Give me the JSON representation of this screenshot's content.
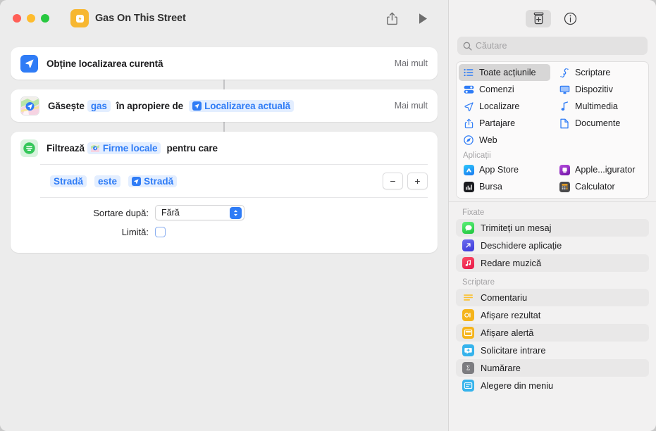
{
  "window": {
    "title": "Gas On This Street",
    "app_icon": "shortcuts-gas-icon",
    "traffic_lights": [
      "close",
      "minimize",
      "zoom"
    ],
    "toolbar": {
      "share_label": "share-icon",
      "run_label": "run-icon"
    }
  },
  "workflow": {
    "actions": [
      {
        "id": "get-current-location",
        "icon": "location-arrow-icon",
        "title": "Obține localizarea curentă",
        "more_label": "Mai mult"
      },
      {
        "id": "find-nearby",
        "icon": "maps-icon",
        "prefix": "Găsește",
        "query_token": "gas",
        "middle": "în apropiere de",
        "location_token": "Localizarea actuală",
        "more_label": "Mai mult"
      },
      {
        "id": "filter-files",
        "icon": "filter-icon",
        "prefix": "Filtrează",
        "subject_token": "Firme locale",
        "suffix": "pentru care",
        "condition": {
          "field": "Stradă",
          "operator": "este",
          "value_token": "Stradă",
          "remove_label": "−",
          "add_label": "+"
        },
        "sort_label": "Sortare după:",
        "sort_value": "Fără",
        "limit_label": "Limită:",
        "limit_checked": false
      }
    ]
  },
  "library": {
    "toolbar": {
      "action_library_icon": "action-library-icon",
      "info_icon": "info-circle-icon"
    },
    "search": {
      "placeholder": "Căutare",
      "value": "",
      "icon": "search-icon"
    },
    "categories": [
      {
        "label": "Toate acțiunile",
        "icon": "list-bullet-icon",
        "selected": true
      },
      {
        "label": "Scriptare",
        "icon": "scripting-icon",
        "selected": false
      },
      {
        "label": "Comenzi",
        "icon": "shortcuts-controls-icon",
        "selected": false
      },
      {
        "label": "Dispozitiv",
        "icon": "display-icon",
        "selected": false
      },
      {
        "label": "Localizare",
        "icon": "location-arrow-icon",
        "selected": false
      },
      {
        "label": "Multimedia",
        "icon": "music-note-icon",
        "selected": false
      },
      {
        "label": "Partajare",
        "icon": "share-icon",
        "selected": false
      },
      {
        "label": "Documente",
        "icon": "document-icon",
        "selected": false
      },
      {
        "label": "Web",
        "icon": "safari-compass-icon",
        "selected": false
      }
    ],
    "apps_heading": "Aplicații",
    "apps": [
      {
        "label": "App Store",
        "icon": "app-store-icon"
      },
      {
        "label": "Apple...igurator",
        "icon": "apple-configurator-icon"
      },
      {
        "label": "Bursa",
        "icon": "stocks-icon"
      },
      {
        "label": "Calculator",
        "icon": "calculator-icon"
      }
    ],
    "sections": [
      {
        "heading": "Fixate",
        "items": [
          {
            "label": "Trimiteți un mesaj",
            "icon": "messages-icon"
          },
          {
            "label": "Deschidere aplicație",
            "icon": "open-app-icon"
          },
          {
            "label": "Redare muzică",
            "icon": "music-icon"
          }
        ]
      },
      {
        "heading": "Scriptare",
        "items": [
          {
            "label": "Comentariu",
            "icon": "comment-icon"
          },
          {
            "label": "Afișare rezultat",
            "icon": "show-result-icon"
          },
          {
            "label": "Afișare alertă",
            "icon": "show-alert-icon"
          },
          {
            "label": "Solicitare intrare",
            "icon": "ask-for-input-icon"
          },
          {
            "label": "Numărare",
            "icon": "count-icon"
          },
          {
            "label": "Alegere din meniu",
            "icon": "choose-from-menu-icon"
          }
        ]
      }
    ]
  },
  "colors": {
    "accent_blue": "#2f7cf6",
    "token_bg": "#e3eeff",
    "window_bg": "#ececec",
    "library_bg": "#f2f1f1",
    "card_bg": "#ffffff"
  }
}
